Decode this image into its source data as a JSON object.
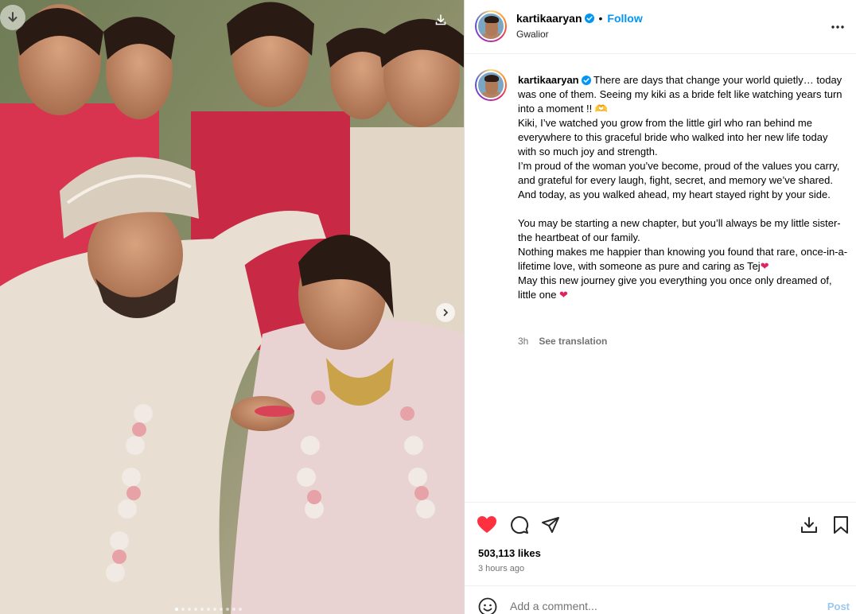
{
  "post": {
    "username": "kartikaaryan",
    "follow_label": "Follow",
    "separator": "•",
    "location": "Gwalior"
  },
  "caption": {
    "username": "kartikaaryan",
    "lines": [
      "There are days that change your world quietly… today was one of them. Seeing my kiki as a bride felt like watching years turn into a moment !! 🫶",
      "Kiki, I’ve watched you grow from the little girl who ran behind me everywhere to this graceful bride who walked into her new life today with so much joy and strength.",
      "I’m proud of the woman you’ve become, proud of the values you carry, and grateful for every laugh, fight, secret, and memory we’ve shared.",
      "And today, as you walked ahead, my heart stayed right by your side.",
      "",
      "You may be starting a new chapter, but you’ll always be my little sister- the heartbeat of our family.",
      "Nothing makes me happier than knowing you found that rare, once-in-a-lifetime love, with someone as pure and caring as Tej",
      "May this new journey give you everything you once only dreamed of, little one"
    ],
    "heart": "❤",
    "time": "3h",
    "see_translation": "See translation"
  },
  "actions": {
    "likes": "503,113 likes",
    "posted": "3 hours ago"
  },
  "comment": {
    "placeholder": "Add a comment...",
    "post_label": "Post"
  },
  "carousel": {
    "dot_count": 11,
    "active_index": 0
  },
  "colors": {
    "accent": "#0095f6",
    "like_red": "#ff3040",
    "post_disabled": "#9ac8f0"
  },
  "icons": {
    "verified": "verified-badge-icon",
    "more": "more-options-icon",
    "like": "heart-filled-icon",
    "comment": "comment-bubble-icon",
    "share": "paper-plane-icon",
    "save_download": "download-tray-icon",
    "bookmark": "bookmark-icon",
    "emoji": "smiley-icon",
    "next": "chevron-right-icon"
  }
}
